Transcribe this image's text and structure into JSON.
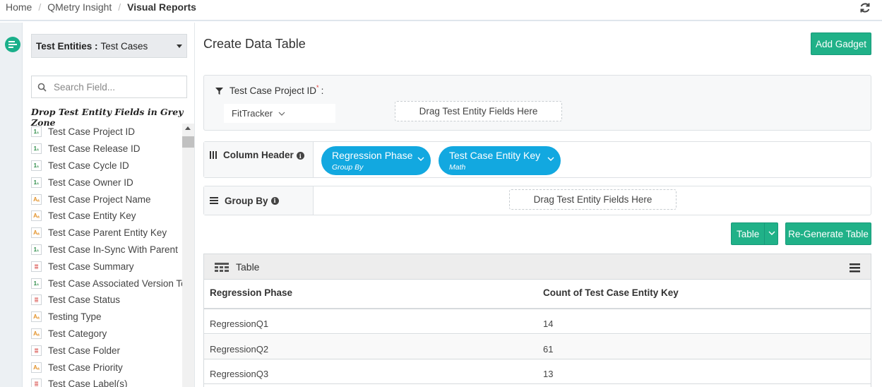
{
  "breadcrumb": {
    "home": "Home",
    "section": "QMetry Insight",
    "current": "Visual Reports"
  },
  "sidebar": {
    "entity_label": "Test Entities :",
    "entity_value": "Test Cases",
    "search_placeholder": "Search Field...",
    "drop_hint": "Drop Test Entity Fields in Grey Zone",
    "fields": [
      {
        "label": "Test Case Project ID",
        "type": "number",
        "icon": "1₁"
      },
      {
        "label": "Test Case Release ID",
        "type": "number",
        "icon": "1₁"
      },
      {
        "label": "Test Case Cycle ID",
        "type": "number",
        "icon": "1₁"
      },
      {
        "label": "Test Case Owner ID",
        "type": "number",
        "icon": "1₁"
      },
      {
        "label": "Test Case Project Name",
        "type": "text",
        "icon": "Aₐ"
      },
      {
        "label": "Test Case Entity Key",
        "type": "text",
        "icon": "Aₐ"
      },
      {
        "label": "Test Case Parent Entity Key",
        "type": "text",
        "icon": "Aₐ"
      },
      {
        "label": "Test Case In-Sync With Parent",
        "type": "number",
        "icon": "1₁"
      },
      {
        "label": "Test Case Summary",
        "type": "list",
        "icon": "≣"
      },
      {
        "label": "Test Case Associated Version To",
        "type": "number",
        "icon": "1₁"
      },
      {
        "label": "Test Case Status",
        "type": "list",
        "icon": "≣"
      },
      {
        "label": "Testing Type",
        "type": "text",
        "icon": "Aₐ"
      },
      {
        "label": "Test Category",
        "type": "text",
        "icon": "Aₐ"
      },
      {
        "label": "Test Case Folder",
        "type": "list",
        "icon": "≣"
      },
      {
        "label": "Test Case Priority",
        "type": "text",
        "icon": "Aₐ"
      },
      {
        "label": "Test Case Label(s)",
        "type": "list",
        "icon": "≣"
      }
    ]
  },
  "main": {
    "title": "Create Data Table",
    "add_gadget": "Add Gadget",
    "filter": {
      "label": "Test Case Project ID",
      "required_mark": "*",
      "colon": ":",
      "selected": "FitTracker",
      "drop_zone": "Drag Test Entity Fields Here"
    },
    "column_header": {
      "label": "Column Header",
      "pills": [
        {
          "title": "Regression Phase",
          "sub": "Group By"
        },
        {
          "title": "Test Case Entity Key",
          "sub": "Math"
        }
      ]
    },
    "group_by": {
      "label": "Group By",
      "drop_zone": "Drag Test Entity Fields Here"
    },
    "table_button": "Table",
    "regenerate_button": "Re-Generate Table",
    "table": {
      "title": "Table",
      "columns": [
        "Regression Phase",
        "Count of Test Case Entity Key"
      ],
      "rows": [
        [
          "RegressionQ1",
          "14"
        ],
        [
          "RegressionQ2",
          "61"
        ],
        [
          "RegressionQ3",
          "13"
        ]
      ]
    }
  },
  "colors": {
    "accent_green": "#20b188",
    "pill_blue": "#12a8e0"
  }
}
